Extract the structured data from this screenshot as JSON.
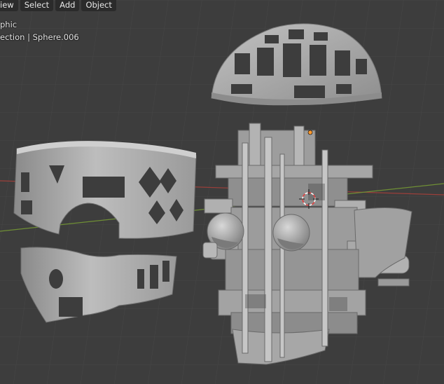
{
  "header": {
    "menu": [
      {
        "label": "iew"
      },
      {
        "label": "Select"
      },
      {
        "label": "Add"
      },
      {
        "label": "Object"
      }
    ]
  },
  "viewport": {
    "view_name": "phic",
    "collection_info": "ection | Sphere.006",
    "object_origin_color": "#ff9a2e",
    "cursor_colors": {
      "ring_a": "#e04040",
      "ring_b": "#ffffff"
    },
    "x_axis_color": "#a0403a",
    "y_axis_color": "#7a9a3a",
    "model_color": "#a9a9a9"
  }
}
